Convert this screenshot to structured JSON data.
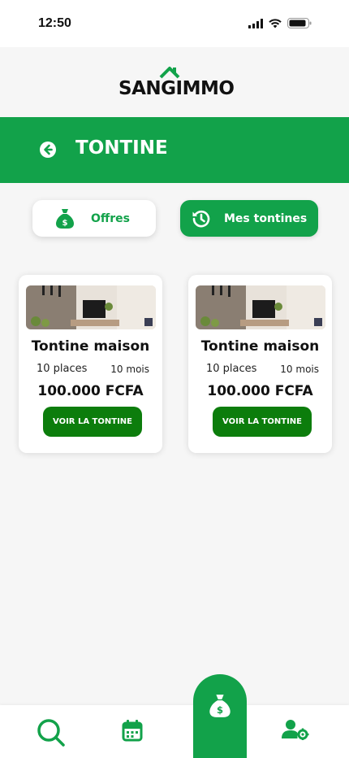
{
  "status_bar": {
    "time": "12:50"
  },
  "brand": {
    "part1": "SAN",
    "part2": "G",
    "part3": "IMMO"
  },
  "title_bar": {
    "title": "TONTINE"
  },
  "tabs": [
    {
      "label": "Offres",
      "icon": "money-bag-icon"
    },
    {
      "label": "Mes tontines",
      "icon": "history-icon"
    }
  ],
  "cards": [
    {
      "title": "Tontine maison",
      "places": "10 places",
      "duration": "10 mois",
      "price": "100.000 FCFA",
      "button": "VOIR LA TONTINE"
    },
    {
      "title": "Tontine maison",
      "places": "10 places",
      "duration": "10 mois",
      "price": "100.000 FCFA",
      "button": "VOIR LA TONTINE"
    }
  ],
  "bottom_nav": [
    {
      "icon": "search-icon"
    },
    {
      "icon": "calendar-icon"
    },
    {
      "icon": "money-bag-icon"
    },
    {
      "icon": "user-settings-icon"
    }
  ],
  "colors": {
    "primary": "#12a24a",
    "button_dark": "#0c7d0c",
    "background": "#f6f6f6"
  }
}
